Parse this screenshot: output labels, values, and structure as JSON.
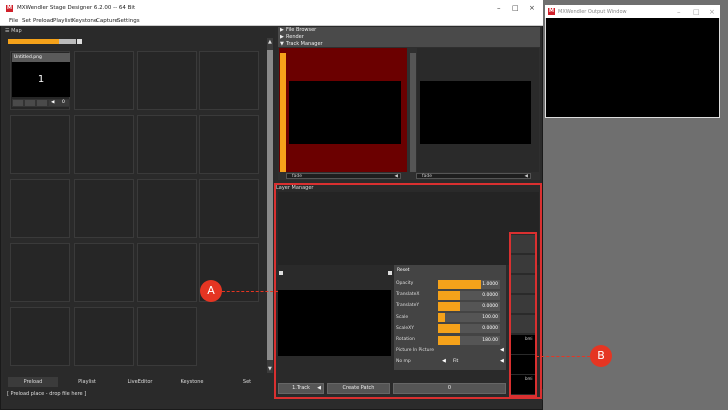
{
  "app": {
    "title": "MXWendler Stage Designer 6.2.00 -- 64 Bit",
    "menu": [
      "File",
      "Set",
      "Preload",
      "Playlist",
      "Keystone",
      "Capture",
      "Settings"
    ]
  },
  "output_window": {
    "title": "MXWendler Output Window"
  },
  "map_panel": {
    "title": "Map",
    "progress": 0.75,
    "first_clip": {
      "name": "Untitled.png",
      "number": "1",
      "counter": "0"
    }
  },
  "left_tabs": [
    "Preload",
    "Playlist",
    "LiveEditor",
    "Keystone",
    "Set"
  ],
  "status_text": "[ Preload place - drop file here ]",
  "sections": {
    "file_browser": "File Browser",
    "render": "Render",
    "track_manager": "Track Manager"
  },
  "tracks": [
    {
      "fade_label": "fade"
    },
    {
      "fade_label": "fade"
    }
  ],
  "layer_manager": {
    "title": "Layer Manager",
    "reset_label": "Reset",
    "properties": [
      {
        "label": "Opacity",
        "value": "1.0000",
        "fill": 0.7
      },
      {
        "label": "TranslateX",
        "value": "0.0000",
        "fill": 0.35
      },
      {
        "label": "TranslateY",
        "value": "0.0000",
        "fill": 0.35
      },
      {
        "label": "Scale",
        "value": "100.00",
        "fill": 0.12
      },
      {
        "label": "ScaleXY",
        "value": "0.0000",
        "fill": 0.35
      },
      {
        "label": "Rotation",
        "value": "180.00",
        "fill": 0.35
      }
    ],
    "picture_in_picture": "Picture In Picture",
    "no_mp": "No mp",
    "fit": "Fit",
    "buttons": {
      "track": "1.Track",
      "create_patch": "Create Patch",
      "zero": "0"
    },
    "right_labels": [
      "bmi",
      "bmi"
    ]
  },
  "callouts": {
    "a": "A",
    "b": "B"
  },
  "colors": {
    "accent_orange": "#f5a21a",
    "track_red": "#6b0000",
    "callout_red": "#e53522"
  }
}
